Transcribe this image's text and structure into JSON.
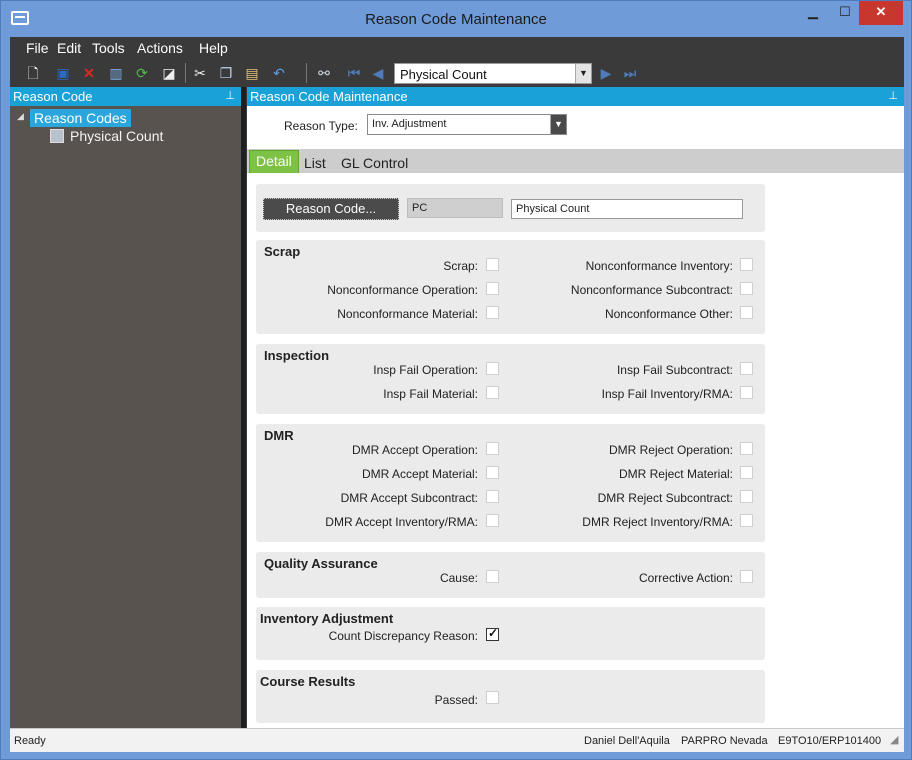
{
  "window": {
    "title": "Reason Code Maintenance",
    "min_glyph": "▁",
    "max_glyph": "☐",
    "close_glyph": "✕"
  },
  "menu": [
    "File",
    "Edit",
    "Tools",
    "Actions",
    "Help"
  ],
  "toolbar": {
    "nav_value": "Physical Count"
  },
  "left_pane": {
    "header": "Reason Code",
    "tree_root": "Reason Codes",
    "tree_child": "Physical Count"
  },
  "right_pane": {
    "header": "Reason Code Maintenance",
    "reason_type_label": "Reason Type:",
    "reason_type_value": "Inv.  Adjustment",
    "tabs": [
      "Detail",
      "List",
      "GL Control"
    ],
    "code_button": "Reason Code...",
    "code_value": "PC",
    "description_value": "Physical Count"
  },
  "sections": {
    "scrap": {
      "title": "Scrap",
      "left": [
        {
          "label": "Scrap:",
          "checked": false
        },
        {
          "label": "Nonconformance Operation:",
          "checked": false
        },
        {
          "label": "Nonconformance Material:",
          "checked": false
        }
      ],
      "right": [
        {
          "label": "Nonconformance Inventory:",
          "checked": false
        },
        {
          "label": "Nonconformance Subcontract:",
          "checked": false
        },
        {
          "label": "Nonconformance Other:",
          "checked": false
        }
      ]
    },
    "inspection": {
      "title": "Inspection",
      "left": [
        {
          "label": "Insp Fail Operation:",
          "checked": false
        },
        {
          "label": "Insp Fail Material:",
          "checked": false
        }
      ],
      "right": [
        {
          "label": "Insp Fail Subcontract:",
          "checked": false
        },
        {
          "label": "Insp Fail Inventory/RMA:",
          "checked": false
        }
      ]
    },
    "dmr": {
      "title": "DMR",
      "left": [
        {
          "label": "DMR Accept Operation:",
          "checked": false
        },
        {
          "label": "DMR Accept Material:",
          "checked": false
        },
        {
          "label": "DMR Accept Subcontract:",
          "checked": false
        },
        {
          "label": "DMR Accept Inventory/RMA:",
          "checked": false
        }
      ],
      "right": [
        {
          "label": "DMR Reject Operation:",
          "checked": false
        },
        {
          "label": "DMR Reject Material:",
          "checked": false
        },
        {
          "label": "DMR Reject Subcontract:",
          "checked": false
        },
        {
          "label": "DMR Reject Inventory/RMA:",
          "checked": false
        }
      ]
    },
    "qa": {
      "title": "Quality Assurance",
      "left": [
        {
          "label": "Cause:",
          "checked": false
        }
      ],
      "right": [
        {
          "label": "Corrective Action:",
          "checked": false
        }
      ]
    },
    "inventory_adjustment": {
      "title": "Inventory Adjustment",
      "left": [
        {
          "label": "Count Discrepancy Reason:",
          "checked": true
        }
      ]
    },
    "course_results": {
      "title": "Course Results",
      "left": [
        {
          "label": "Passed:",
          "checked": false
        }
      ]
    }
  },
  "status": {
    "left": "Ready",
    "user": "Daniel Dell'Aquila",
    "company": "PARPRO Nevada",
    "server": "E9TO10/ERP101400"
  },
  "colors": {
    "accent": "#1aa2d8",
    "tab_active": "#7dc244",
    "pane_dark": "#58534f"
  }
}
